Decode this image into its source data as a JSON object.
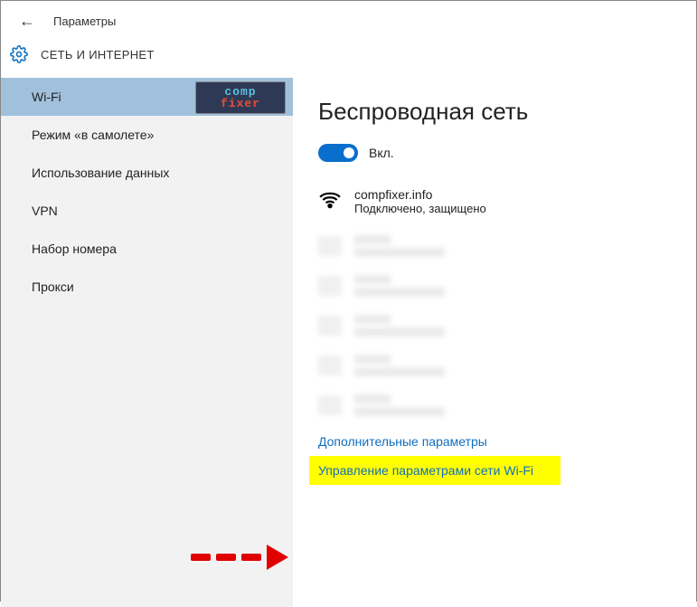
{
  "header": {
    "title": "Параметры"
  },
  "subheader": {
    "title": "СЕТЬ И ИНТЕРНЕТ"
  },
  "sidebar": {
    "items": [
      {
        "label": "Wi-Fi",
        "active": true
      },
      {
        "label": "Режим «в самолете»"
      },
      {
        "label": "Использование данных"
      },
      {
        "label": "VPN"
      },
      {
        "label": "Набор номера"
      },
      {
        "label": "Прокси"
      }
    ]
  },
  "watermark": {
    "line1": "comp",
    "line2": "fixer"
  },
  "content": {
    "title": "Беспроводная сеть",
    "toggle_label": "Вкл.",
    "network": {
      "name": "compfixer.info",
      "status": "Подключено, защищено"
    },
    "links": {
      "additional": "Дополнительные параметры",
      "manage": "Управление параметрами сети Wi-Fi"
    }
  }
}
